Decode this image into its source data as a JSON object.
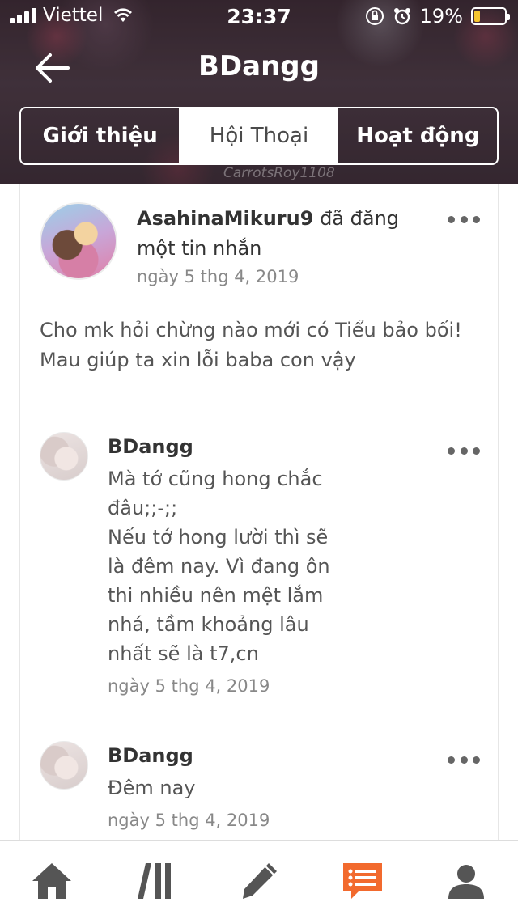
{
  "status_bar": {
    "carrier": "Viettel",
    "time": "23:37",
    "battery_percent": "19%",
    "battery_level": 0.19
  },
  "header": {
    "title": "BDangg",
    "watermark": "CarrotsRoy1108",
    "tabs": [
      {
        "label": "Giới thiệu",
        "active": false
      },
      {
        "label": "Hội Thoại",
        "active": true
      },
      {
        "label": "Hoạt động",
        "active": false
      }
    ]
  },
  "post": {
    "author": "AsahinaMikuru9",
    "action": " đã đăng một tin nhắn",
    "date": "ngày 5 thg 4, 2019",
    "body": "Cho mk hỏi chừng nào mới có Tiểu bảo bối! Mau giúp ta xin lỗi baba con vậy"
  },
  "comments": [
    {
      "author": "BDangg",
      "text": "Mà tớ cũng hong chắc đâu;;-;;\nNếu tớ hong lười thì sẽ là đêm nay. Vì đang ôn thi nhiều nên mệt lắm nhá, tầm khoảng lâu nhất sẽ là t7,cn",
      "date": "ngày 5 thg 4, 2019"
    },
    {
      "author": "BDangg",
      "text": "Đêm nay",
      "date": "ngày 5 thg 4, 2019"
    }
  ],
  "bottom_nav": {
    "items": [
      {
        "name": "home-icon",
        "active": false
      },
      {
        "name": "library-icon",
        "active": false
      },
      {
        "name": "pencil-icon",
        "active": false
      },
      {
        "name": "chat-icon",
        "active": true
      },
      {
        "name": "profile-icon",
        "active": false
      }
    ],
    "active_color": "#f26a2e",
    "inactive_color": "#555555"
  }
}
